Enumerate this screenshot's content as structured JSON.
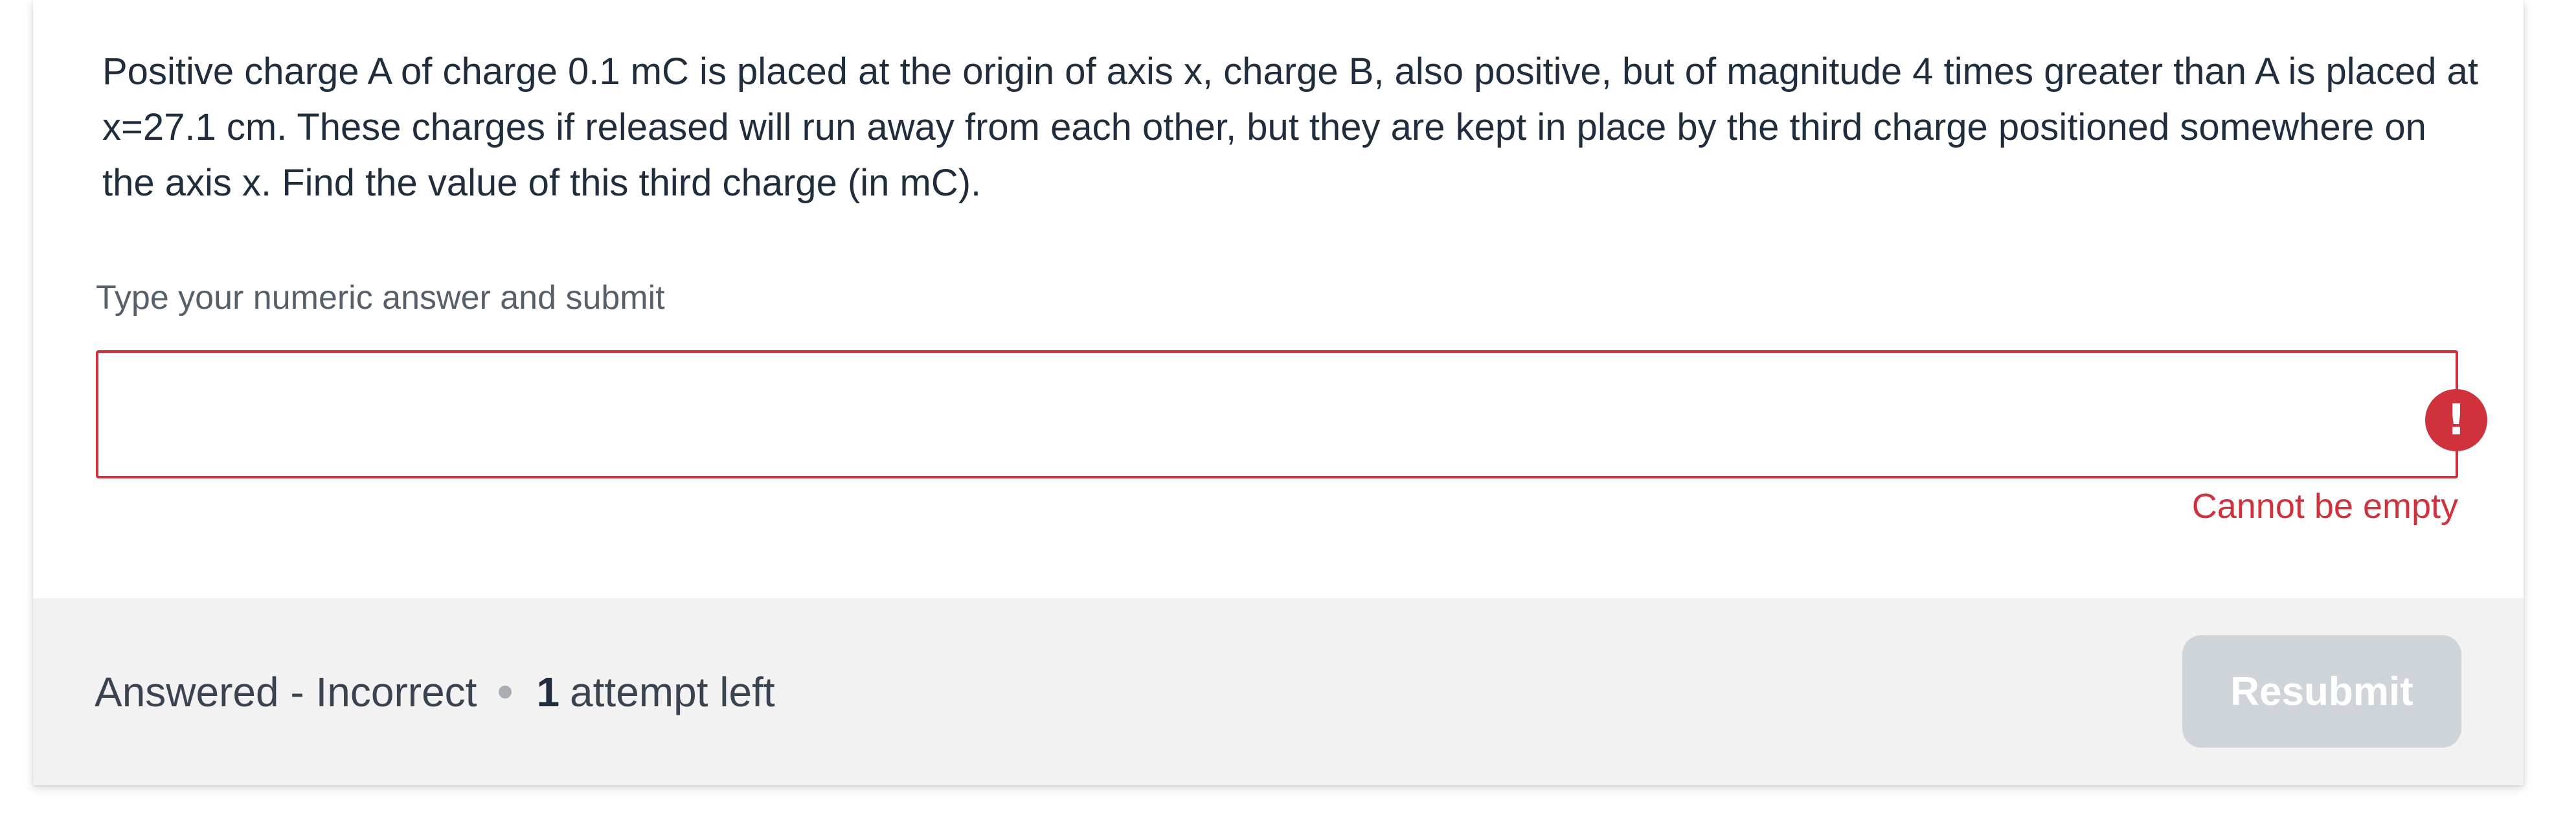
{
  "question": {
    "text": "Positive charge A of charge 0.1 mC is placed at the origin of axis x, charge B, also positive, but of magnitude 4 times greater than A is placed at x=27.1 cm. These charges if released will run away from each other, but they are kept in place by the third charge positioned somewhere on the axis x. Find the value of this third charge (in mC)."
  },
  "answer": {
    "prompt": "Type your numeric answer and submit",
    "value": "",
    "placeholder": "",
    "error_icon": "exclamation-icon",
    "error_glyph": "!",
    "error_message": "Cannot be empty",
    "error_color": "#d0323d"
  },
  "footer": {
    "status": "Answered - Incorrect",
    "attempts_count": "1",
    "attempts_suffix": "attempt left",
    "resubmit_label": "Resubmit"
  }
}
